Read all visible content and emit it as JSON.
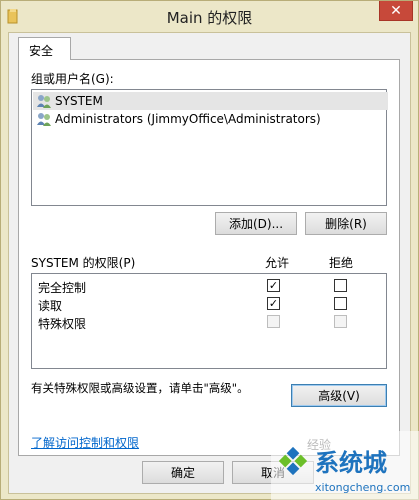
{
  "window": {
    "title": "Main 的权限",
    "close_label": "✕"
  },
  "tab": {
    "label": "安全"
  },
  "groups": {
    "label": "组或用户名(G):",
    "items": [
      {
        "name": "SYSTEM",
        "selected": true
      },
      {
        "name": "Administrators (JimmyOffice\\Administrators)",
        "selected": false
      }
    ],
    "add_label": "添加(D)...",
    "remove_label": "删除(R)"
  },
  "permissions": {
    "header": "SYSTEM 的权限(P)",
    "allow_header": "允许",
    "deny_header": "拒绝",
    "rows": [
      {
        "name": "完全控制",
        "allow": "✓",
        "deny": ""
      },
      {
        "name": "读取",
        "allow": "✓",
        "deny": ""
      },
      {
        "name": "特殊权限",
        "allow": "",
        "deny": ""
      }
    ]
  },
  "advanced": {
    "hint": "有关特殊权限或高级设置，请单击\"高级\"。",
    "button_label": "高级(V)"
  },
  "link": {
    "label": "了解访问控制和权限"
  },
  "footer": {
    "ok_label": "确定",
    "cancel_label": "取消"
  },
  "watermark": {
    "text": "系统城",
    "url": "xitongcheng.com",
    "faded_text": "经验"
  },
  "colors": {
    "titlebar": "#ece7c8",
    "close": "#c7493a",
    "link": "#0066cc",
    "watermark_blue": "#1e73be",
    "watermark_green": "#6cbf2a"
  }
}
